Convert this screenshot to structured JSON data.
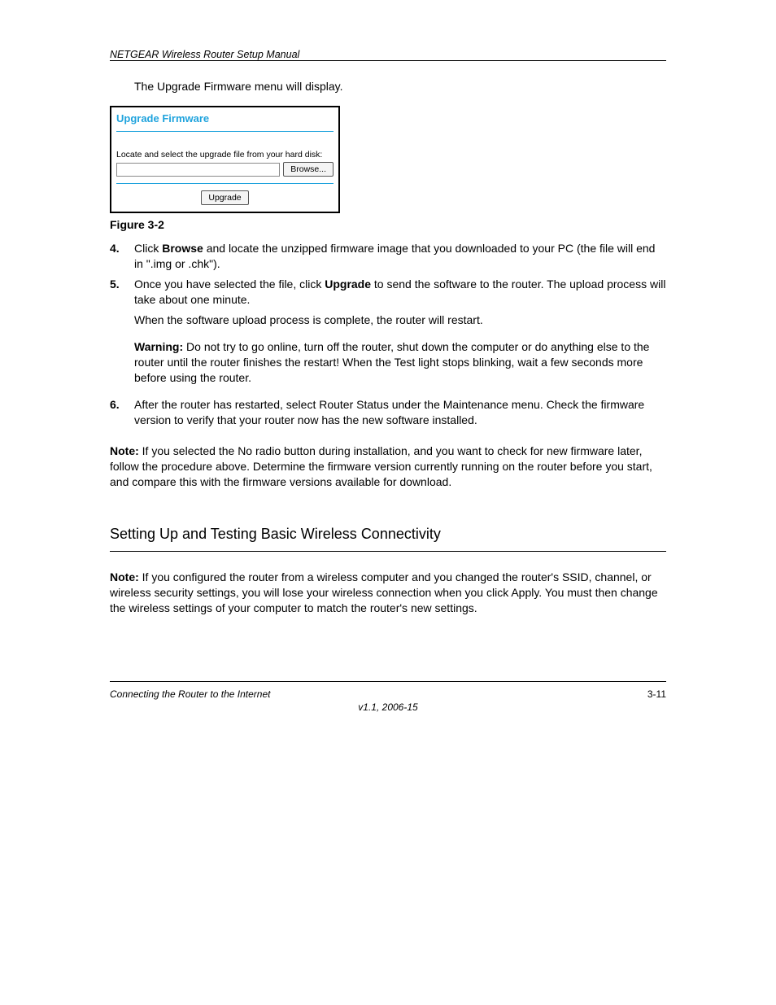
{
  "header": {
    "left": "NETGEAR Wireless Router Setup Manual"
  },
  "body": {
    "intro": "The Upgrade Firmware menu will display.",
    "figure": {
      "panel_title": "Upgrade Firmware",
      "instruction": "Locate and select the upgrade file from your hard disk:",
      "browse_label": "Browse...",
      "upgrade_label": "Upgrade",
      "caption": "Figure 3-2"
    },
    "step4_num": "4.",
    "step4_text_a": "Click ",
    "step4_browse": "Browse",
    "step4_text_b": " and locate the unzipped firmware image that you downloaded to your PC (the file will end in \".img or .chk\").",
    "step5_num": "5.",
    "step5_text_a": "Once you have selected the file, click ",
    "step5_upgrade": "Upgrade ",
    "step5_text_b": "to send the software to the router. The upload process will take about one minute.",
    "after_upload": "When the software upload process is complete, the router will restart.",
    "warning_label": "Warning:",
    "warning_text": " Do not try to go online, turn off the router, shut down the computer or do anything else to the router until the router finishes the restart! When the Test light stops blinking, wait a few seconds more before using the router.",
    "step6_num": "6.",
    "step6_text": "After the router has restarted, select Router Status under the Maintenance menu. Check the firmware version to verify that your router now has the new software installed.",
    "note_label": "Note: ",
    "note_text": "If you selected the No radio button during installation, and you want to check for new firmware later, follow the procedure above. Determine the firmware version currently running on the router before you start, and compare this with the firmware versions available for download.",
    "section2_title": "Setting Up and Testing Basic Wireless Connectivity",
    "section2_note_label": "Note: ",
    "section2_note_text": "If you configured the router from a wireless computer and you changed the router's SSID, channel, or wireless security settings, you will lose your wireless connection when you click Apply. You must then change the wireless settings of your computer to match the router's new settings."
  },
  "footer": {
    "left": "Connecting the Router to the Internet",
    "right": "3-11",
    "version": "v1.1, 2006-15"
  }
}
